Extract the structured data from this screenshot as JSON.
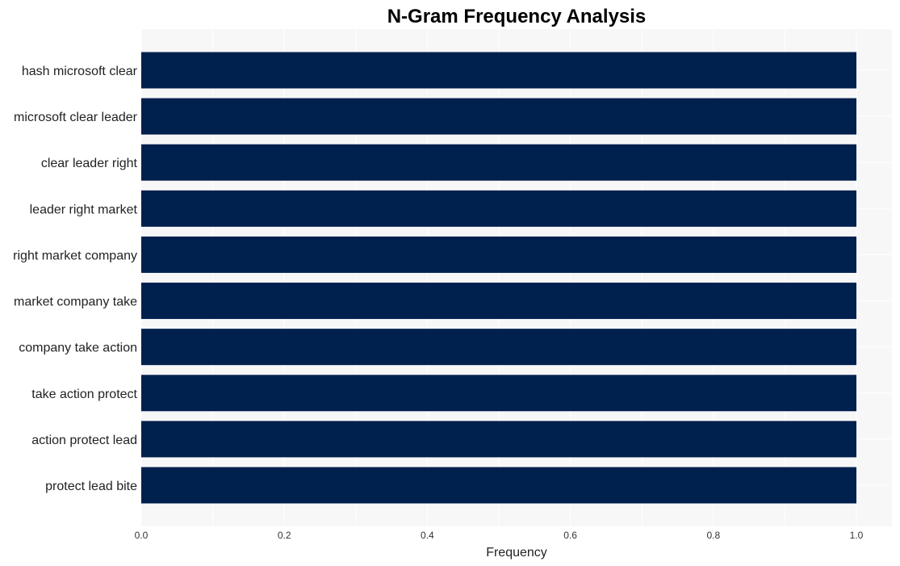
{
  "chart_data": {
    "type": "bar",
    "orientation": "horizontal",
    "title": "N-Gram Frequency Analysis",
    "xlabel": "Frequency",
    "ylabel": "",
    "categories": [
      "hash microsoft clear",
      "microsoft clear leader",
      "clear leader right",
      "leader right market",
      "right market company",
      "market company take",
      "company take action",
      "take action protect",
      "action protect lead",
      "protect lead bite"
    ],
    "values": [
      1,
      1,
      1,
      1,
      1,
      1,
      1,
      1,
      1,
      1
    ],
    "xlim": [
      0,
      1.05
    ],
    "xticks": [
      0.0,
      0.2,
      0.4,
      0.6,
      0.8,
      1.0
    ],
    "xtick_labels": [
      "0.0",
      "0.2",
      "0.4",
      "0.6",
      "0.8",
      "1.0"
    ],
    "grid": true,
    "legend": "none",
    "colors": {
      "bar": "#00204e",
      "plot_background": "#f7f7f7",
      "grid": "#ffffff"
    }
  }
}
